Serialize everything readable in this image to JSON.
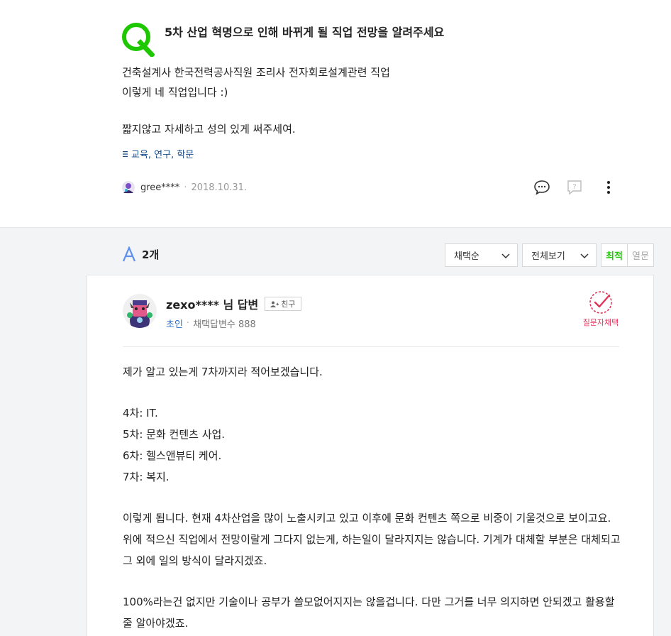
{
  "question": {
    "title": "5차 산업 혁명으로 인해 바뀌게 될 직업 전망을 알려주세요",
    "body_lines": [
      "건축설계사 한국전력공사직원 조리사 전자회로설계관련 직업",
      "이렇게 네 직업입니다 :)",
      "짧지않고 자세하고 성의 있게 써주세여."
    ],
    "category": "교육, 연구, 학문",
    "author": "gree****",
    "date": "2018.10.31."
  },
  "answers_header": {
    "count_label": "2개",
    "sort_select": "채택순",
    "view_select": "전체보기",
    "toggle_on": "최적",
    "toggle_off": "열문"
  },
  "answer": {
    "user": "zexo**** 님 답변",
    "friend_label": "친구",
    "grade": "초인",
    "adopt_count": "채택답변수 888",
    "choose_label": "질문자채택",
    "paragraphs": [
      "제가 알고 있는게 7차까지라 적어보겠습니다.",
      "4차: IT.",
      "5차: 문화 컨텐츠 사업.",
      "6차: 헬스앤뷰티 케어.",
      "7차: 복지.",
      "이렇게 됩니다. 현재 4차산업을 많이 노출시키고 있고 이후에 문화 컨텐츠 쪽으로 비중이 기울것으로 보이고요. 위에 적으신 직업에서 전망이랄게 그다지 없는게, 하는일이 달라지지는 않습니다. 기계가 대체할 부분은 대체되고 그 외에 일의 방식이 달라지겠죠.",
      "100%라는건 없지만 기술이나 공부가 쓸모없어지지는 않을겁니다. 다만 그거를 너무 의지하면 안되겠고 활용할줄 알아야겠죠."
    ]
  },
  "colors": {
    "q_green": "#1ec800",
    "a_blue": "#5b8ff0",
    "accent_red": "#e0335a",
    "link_blue": "#2b6fce"
  },
  "icons": [
    "q-mark-icon",
    "category-icon",
    "comment-icon",
    "report-icon",
    "more-icon",
    "a-mark-icon",
    "chevron-down-icon",
    "friend-add-icon",
    "choose-check-icon"
  ]
}
